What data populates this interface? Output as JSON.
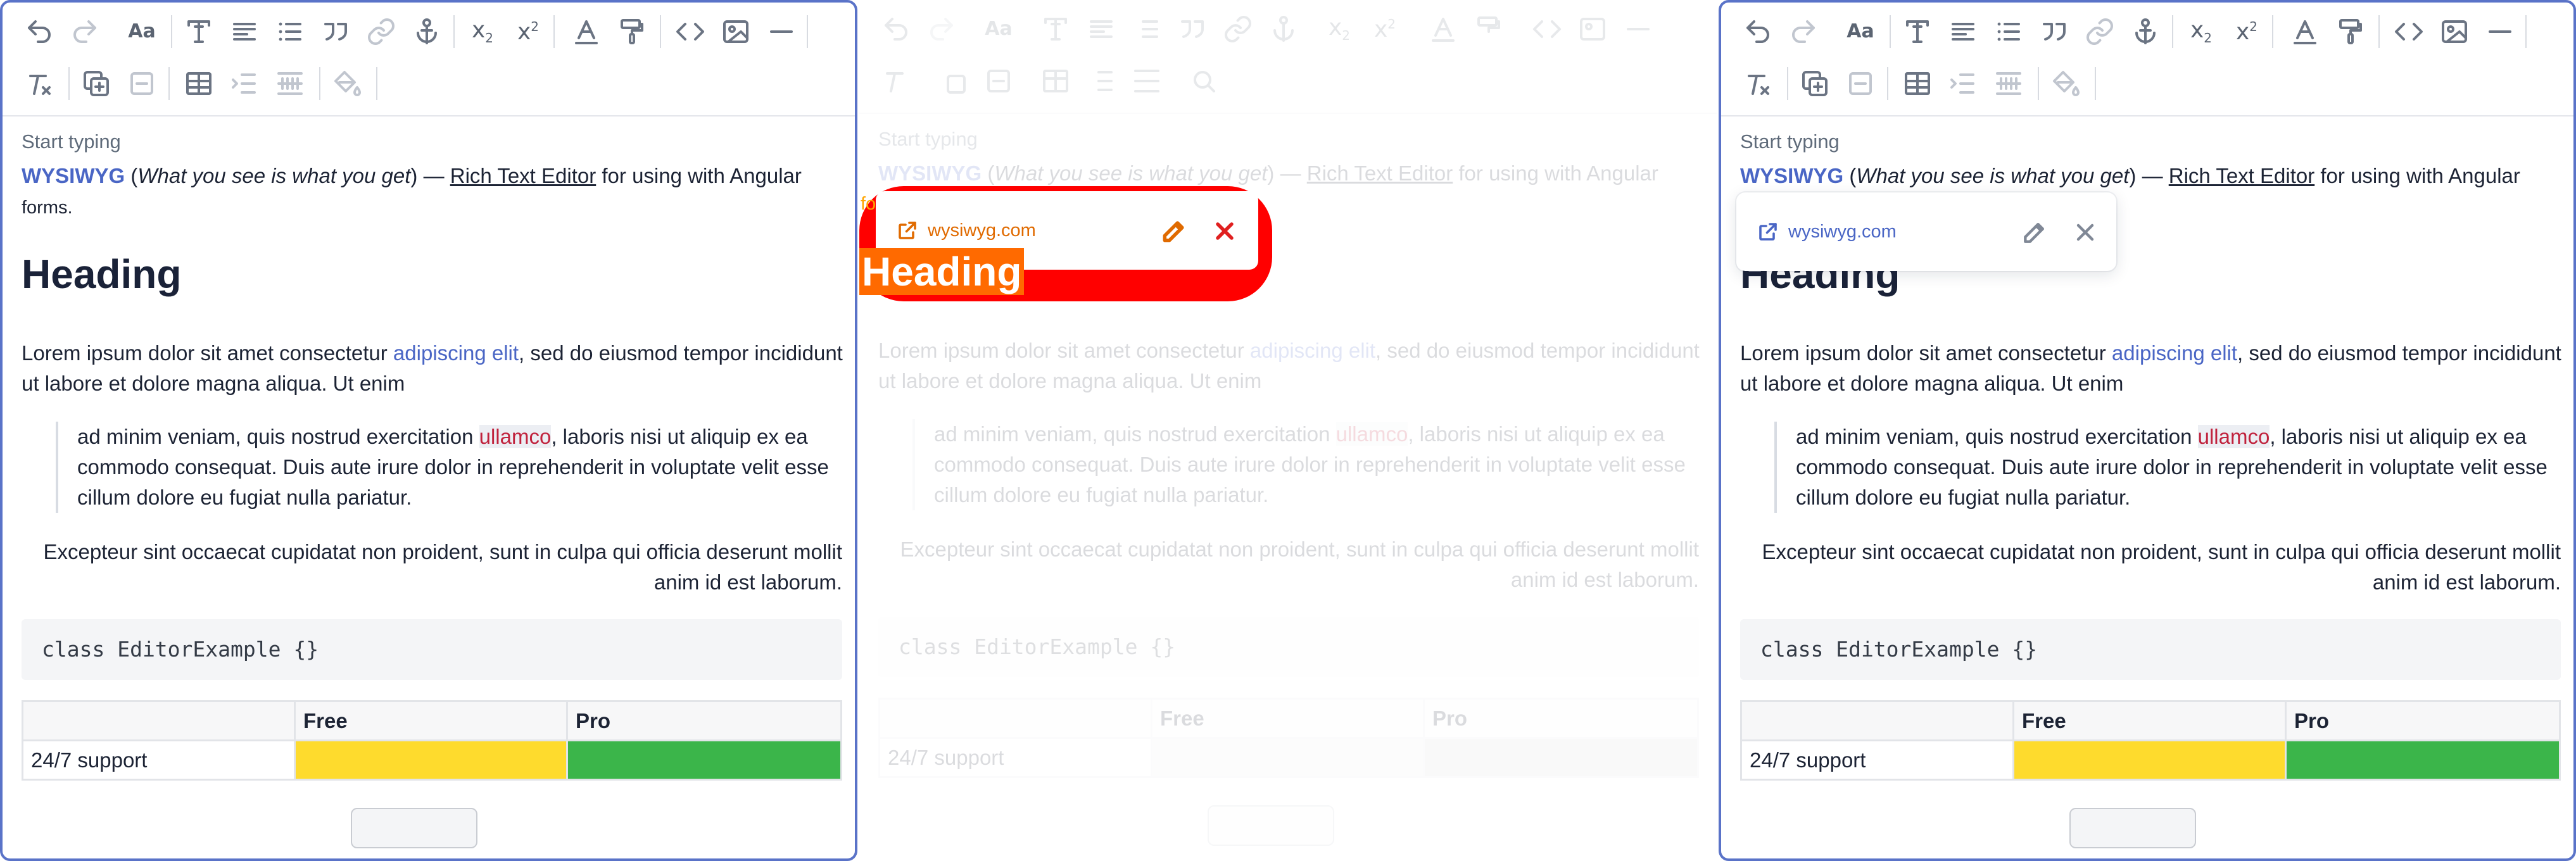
{
  "editor": {
    "placeholder": "Start typing",
    "intro": {
      "brand": "WYSIWYG",
      "paren_open": " (",
      "expansion": "What you see is what you get",
      "dash": ") — ",
      "rte_link": "Rich Text Editor",
      "rest": " for using with Angular",
      "small": "forms."
    },
    "heading": "Heading",
    "para": {
      "before": "Lorem ipsum dolor sit amet consectetur ",
      "link": "adipiscing elit",
      "after": ", sed do eiusmod tempor incididunt ut labore et dolore magna aliqua. Ut enim"
    },
    "quote": {
      "before": "ad minim veniam, quis nostrud exercitation ",
      "mark": "ullamco",
      "after": ", laboris nisi ut aliquip ex ea commodo consequat. Duis aute irure dolor in reprehenderit in voluptate velit esse cillum dolore eu fugiat nulla pariatur."
    },
    "right_para": "Excepteur sint occaecat cupidatat non proident, sunt in culpa qui officia deserunt mollit anim id est laborum.",
    "code": "class EditorExample {}",
    "table": {
      "headers": [
        "",
        "Free",
        "Pro"
      ],
      "row_label": "24/7 support"
    }
  },
  "link_popup": {
    "url": "wysiwyg.com"
  },
  "colors": {
    "accent": "#4a66c5",
    "border_active": "#5a73c8",
    "highlight_red": "#ff0000",
    "cell_yellow": "#fedb2d",
    "cell_green": "#3bb54a",
    "mark_red": "#c0213c"
  },
  "toolbar_icons": [
    "undo-icon",
    "redo-icon",
    "font-size-icon",
    "text-style-icon",
    "align-icon",
    "bullet-list-icon",
    "blockquote-icon",
    "link-icon",
    "anchor-icon",
    "subscript-icon",
    "superscript-icon",
    "text-color-icon",
    "highlight-icon",
    "code-icon",
    "image-icon",
    "horizontal-rule-icon",
    "clear-format-icon",
    "insert-group-icon",
    "remove-group-icon",
    "table-icon",
    "indent-icon",
    "grid-icon",
    "paint-bucket-icon"
  ]
}
